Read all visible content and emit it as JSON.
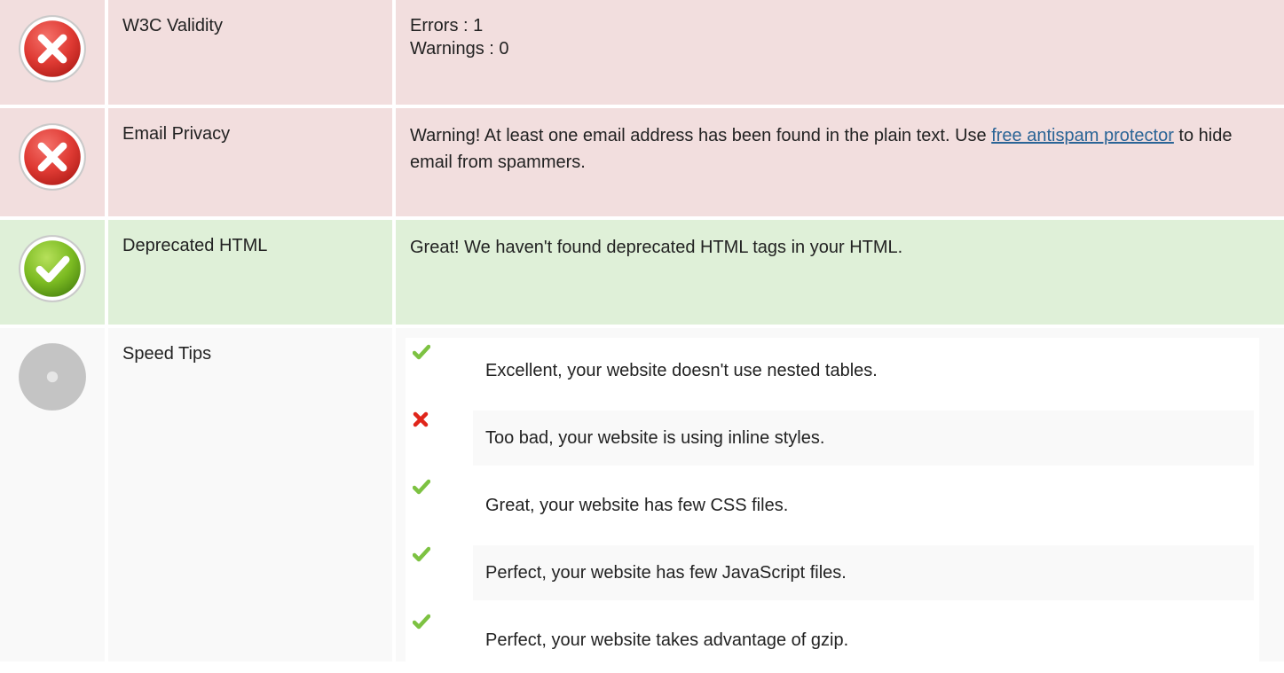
{
  "colors": {
    "error_bg": "#f2dede",
    "success_bg": "#dff0d8",
    "neutral_bg": "#f9f9f9",
    "link": "#2a6496",
    "check_green": "#7dc242",
    "cross_red": "#e0261b"
  },
  "rows": [
    {
      "status": "error",
      "icon": "error-circle-icon",
      "label": "W3C Validity",
      "lines": [
        "Errors : 1",
        "Warnings : 0"
      ]
    },
    {
      "status": "error",
      "icon": "error-circle-icon",
      "label": "Email Privacy",
      "text_before": "Warning! At least one email address has been found in the plain text. Use ",
      "link_text": "free antispam protector",
      "text_after": " to hide email from spammers."
    },
    {
      "status": "success",
      "icon": "success-check-circle-icon",
      "label": "Deprecated HTML",
      "text": "Great! We haven't found deprecated HTML tags in your HTML."
    },
    {
      "status": "neutral",
      "icon": "neutral-circle-icon",
      "label": "Speed Tips",
      "tips": [
        {
          "icon": "check-icon",
          "text": "Excellent, your website doesn't use nested tables."
        },
        {
          "icon": "cross-icon",
          "text": "Too bad, your website is using inline styles."
        },
        {
          "icon": "check-icon",
          "text": "Great, your website has few CSS files."
        },
        {
          "icon": "check-icon",
          "text": "Perfect, your website has few JavaScript files."
        },
        {
          "icon": "check-icon",
          "text": "Perfect, your website takes advantage of gzip."
        }
      ]
    }
  ]
}
